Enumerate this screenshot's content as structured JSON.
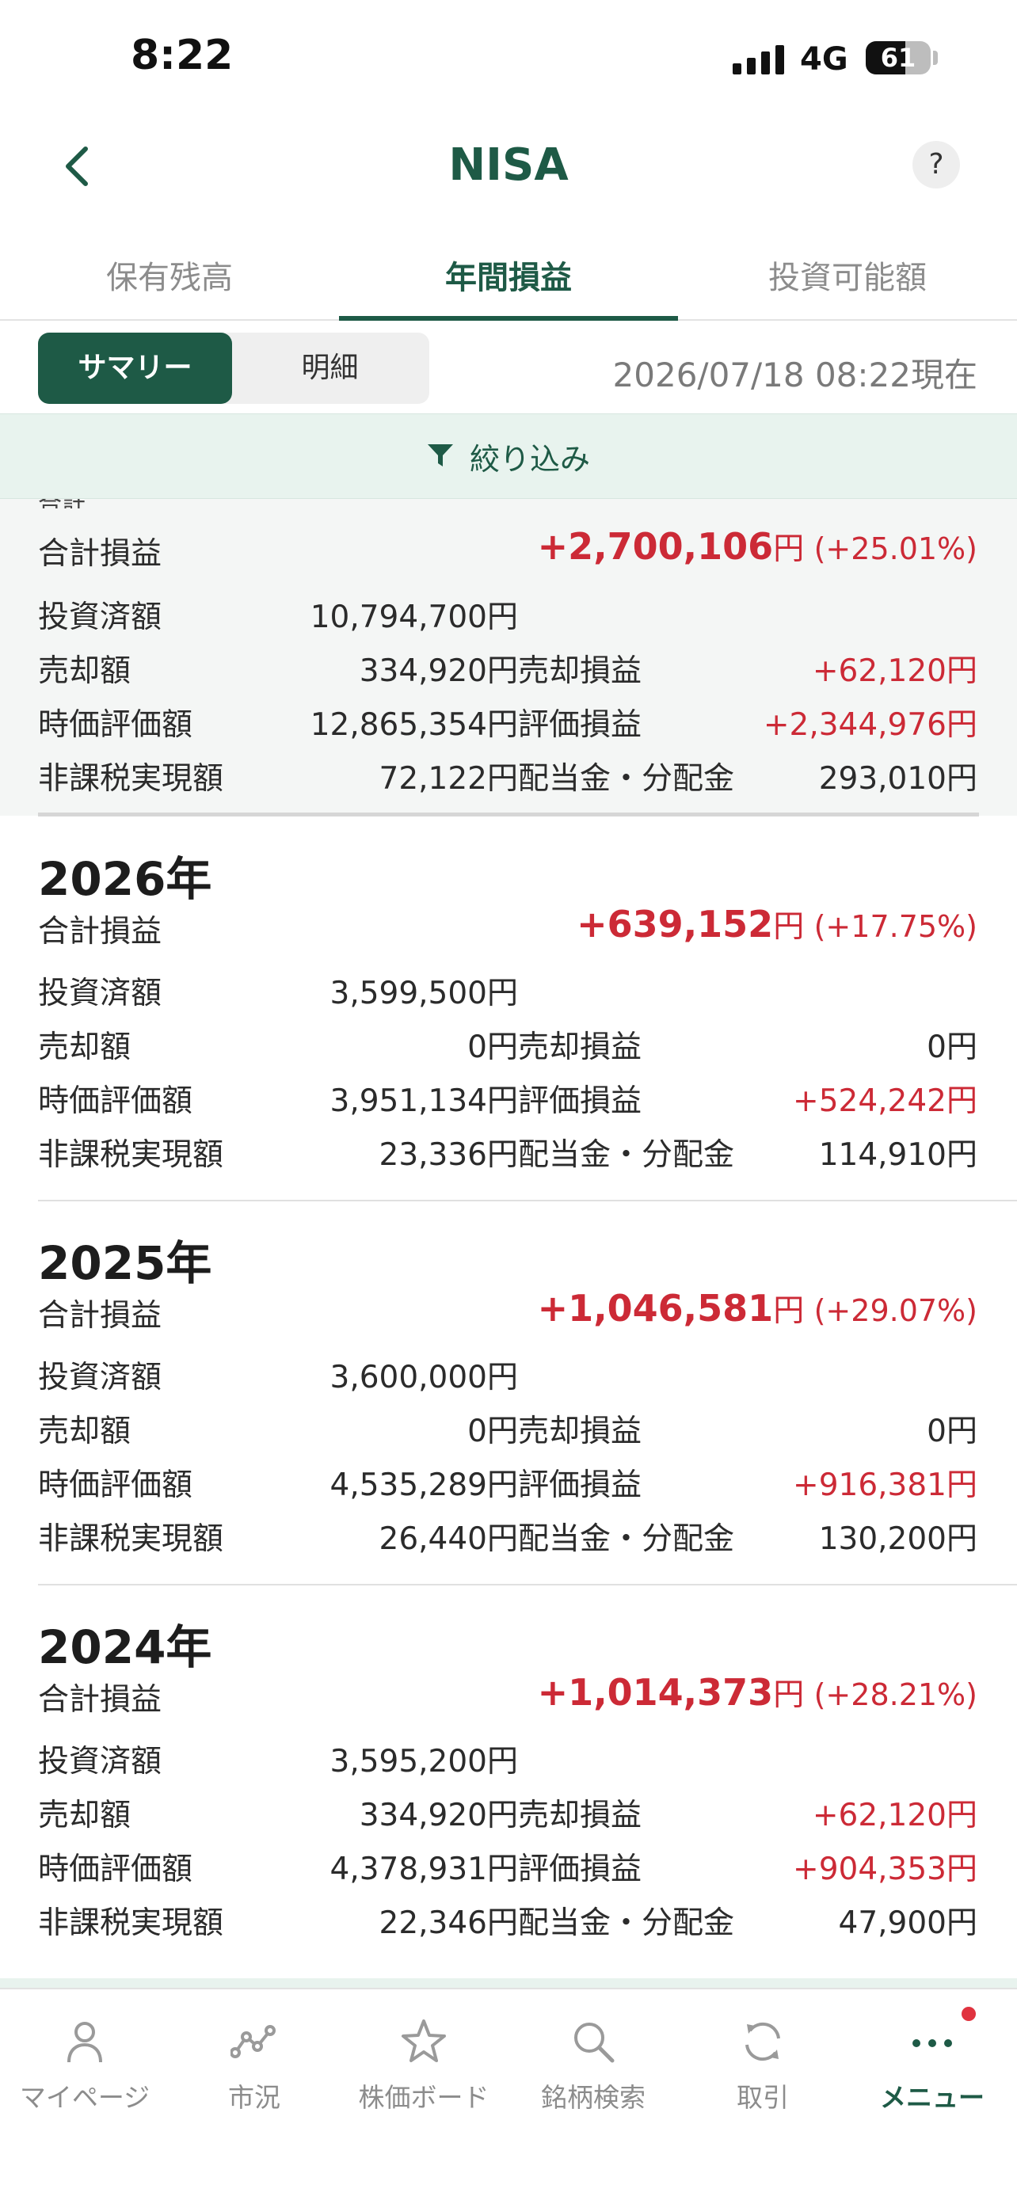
{
  "status": {
    "time": "8:22",
    "network": "4G",
    "battery": "61"
  },
  "nav": {
    "title": "NISA",
    "help": "?"
  },
  "tabs": [
    {
      "label": "保有残高"
    },
    {
      "label": "年間損益"
    },
    {
      "label": "投資可能額"
    }
  ],
  "segment": {
    "summary": "サマリー",
    "detail": "明細"
  },
  "as_of": "2026/07/18 08:22現在",
  "filter": {
    "label": "絞り込み"
  },
  "labels": {
    "total_pl": "合計損益",
    "invested": "投資済額",
    "sold": "売却額",
    "sale_pl": "売却損益",
    "market_value": "時価評価額",
    "unrealized": "評価損益",
    "tax_free_realized": "非課税実現額",
    "dividend": "配当金・分配金",
    "yen": "円"
  },
  "total": {
    "header_partial": "合計",
    "total_pl": "+2,700,106",
    "total_pct": "(+25.01%)",
    "invested": "10,794,700円",
    "sold": "334,920円",
    "sale_pl": "+62,120円",
    "market_value": "12,865,354円",
    "unrealized": "+2,344,976円",
    "tax_free_realized": "72,122円",
    "dividend": "293,010円"
  },
  "years": [
    {
      "year": "2026年",
      "total_pl": "+639,152",
      "total_pct": "(+17.75%)",
      "invested": "3,599,500円",
      "sold": "0円",
      "sale_pl": "0円",
      "market_value": "3,951,134円",
      "unrealized": "+524,242円",
      "tax_free_realized": "23,336円",
      "dividend": "114,910円"
    },
    {
      "year": "2025年",
      "total_pl": "+1,046,581",
      "total_pct": "(+29.07%)",
      "invested": "3,600,000円",
      "sold": "0円",
      "sale_pl": "0円",
      "market_value": "4,535,289円",
      "unrealized": "+916,381円",
      "tax_free_realized": "26,440円",
      "dividend": "130,200円"
    },
    {
      "year": "2024年",
      "total_pl": "+1,014,373",
      "total_pct": "(+28.21%)",
      "invested": "3,595,200円",
      "sold": "334,920円",
      "sale_pl": "+62,120円",
      "market_value": "4,378,931円",
      "unrealized": "+904,353円",
      "tax_free_realized": "22,346円",
      "dividend": "47,900円"
    }
  ],
  "tabbar": [
    {
      "label": "マイページ",
      "icon": "person-icon"
    },
    {
      "label": "市況",
      "icon": "market-chart-icon"
    },
    {
      "label": "株価ボード",
      "icon": "star-icon"
    },
    {
      "label": "銘柄検索",
      "icon": "search-icon"
    },
    {
      "label": "取引",
      "icon": "refresh-icon"
    },
    {
      "label": "メニュー",
      "icon": "more-dots-icon"
    }
  ],
  "colors": {
    "brand": "#1e5a46",
    "gain": "#cc2a36",
    "filter_bg": "#e8f3ee"
  }
}
